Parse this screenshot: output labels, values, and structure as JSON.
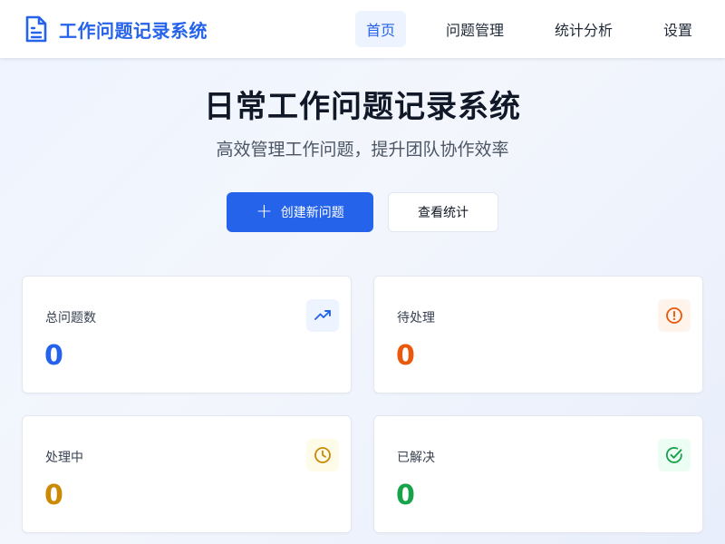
{
  "app": {
    "name": "工作问题记录系统"
  },
  "nav": {
    "items": [
      {
        "label": "首页",
        "active": true
      },
      {
        "label": "问题管理",
        "active": false
      },
      {
        "label": "统计分析",
        "active": false
      },
      {
        "label": "设置",
        "active": false
      }
    ]
  },
  "hero": {
    "title": "日常工作问题记录系统",
    "subtitle": "高效管理工作问题，提升团队协作效率"
  },
  "actions": {
    "create_label": "创建新问题",
    "create_icon": "plus-icon",
    "stats_label": "查看统计"
  },
  "stats": [
    {
      "label": "总问题数",
      "value": "0",
      "icon": "trending-up-icon",
      "color": "#2563eb",
      "bg": "#eef4ff"
    },
    {
      "label": "待处理",
      "value": "0",
      "icon": "alert-circle-icon",
      "color": "#ea580c",
      "bg": "#fff4ec"
    },
    {
      "label": "处理中",
      "value": "0",
      "icon": "clock-icon",
      "color": "#ca8a04",
      "bg": "#fefce8"
    },
    {
      "label": "已解决",
      "value": "0",
      "icon": "check-circle-icon",
      "color": "#16a34a",
      "bg": "#ecfdf3"
    }
  ],
  "colors": {
    "primary": "#2563eb",
    "title": "#111827",
    "text": "#374151"
  }
}
